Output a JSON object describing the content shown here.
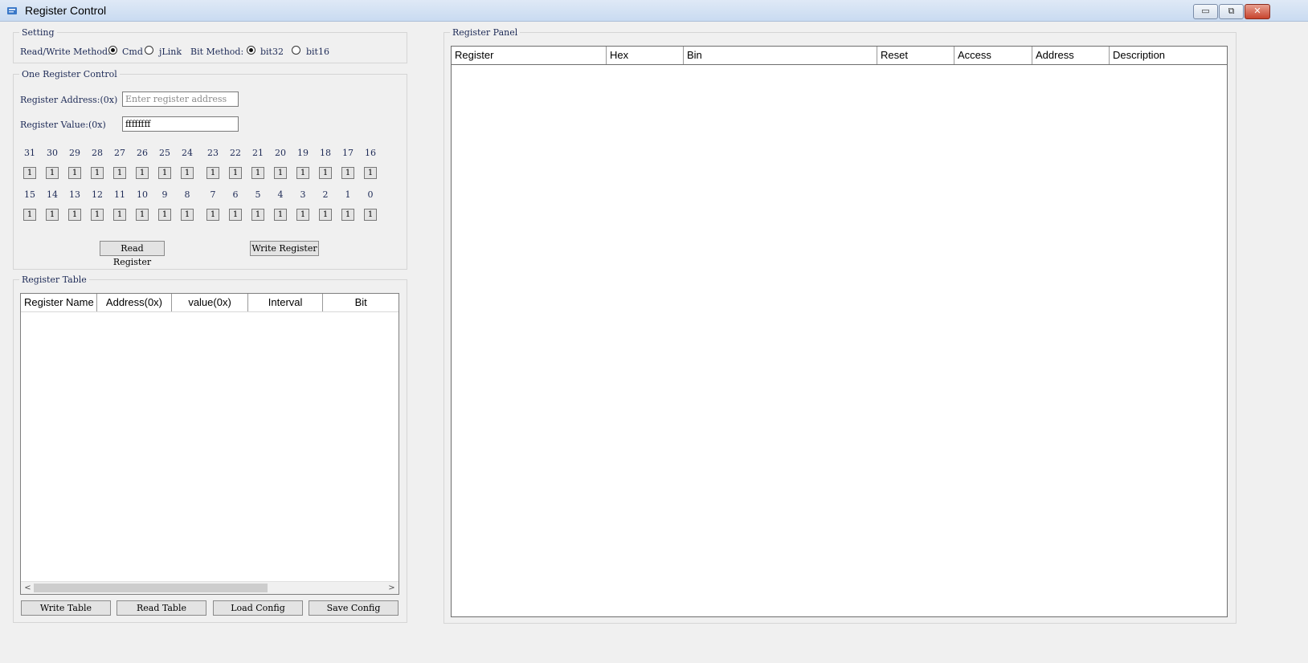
{
  "window": {
    "title": "Register Control",
    "controls": {
      "minimize": "▭",
      "restore": "⧉",
      "close": "✕"
    }
  },
  "setting": {
    "legend": "Setting",
    "rw_label": "Read/Write Method:",
    "rw_options": [
      {
        "label": "Cmd",
        "selected": true
      },
      {
        "label": "jLink",
        "selected": false
      }
    ],
    "bit_label": "Bit Method:",
    "bit_options": [
      {
        "label": "bit32",
        "selected": true
      },
      {
        "label": "bit16",
        "selected": false
      }
    ]
  },
  "one_register": {
    "legend": "One Register Control",
    "address_label": "Register Address:(0x)",
    "address_placeholder": "Enter register address",
    "value_label": "Register Value:(0x)",
    "value": "ffffffff",
    "bits": [
      {
        "n": "31",
        "v": "1"
      },
      {
        "n": "30",
        "v": "1"
      },
      {
        "n": "29",
        "v": "1"
      },
      {
        "n": "28",
        "v": "1"
      },
      {
        "n": "27",
        "v": "1"
      },
      {
        "n": "26",
        "v": "1"
      },
      {
        "n": "25",
        "v": "1"
      },
      {
        "n": "24",
        "v": "1"
      },
      {
        "n": "23",
        "v": "1"
      },
      {
        "n": "22",
        "v": "1"
      },
      {
        "n": "21",
        "v": "1"
      },
      {
        "n": "20",
        "v": "1"
      },
      {
        "n": "19",
        "v": "1"
      },
      {
        "n": "18",
        "v": "1"
      },
      {
        "n": "17",
        "v": "1"
      },
      {
        "n": "16",
        "v": "1"
      },
      {
        "n": "15",
        "v": "1"
      },
      {
        "n": "14",
        "v": "1"
      },
      {
        "n": "13",
        "v": "1"
      },
      {
        "n": "12",
        "v": "1"
      },
      {
        "n": "11",
        "v": "1"
      },
      {
        "n": "10",
        "v": "1"
      },
      {
        "n": "9",
        "v": "1"
      },
      {
        "n": "8",
        "v": "1"
      },
      {
        "n": "7",
        "v": "1"
      },
      {
        "n": "6",
        "v": "1"
      },
      {
        "n": "5",
        "v": "1"
      },
      {
        "n": "4",
        "v": "1"
      },
      {
        "n": "3",
        "v": "1"
      },
      {
        "n": "2",
        "v": "1"
      },
      {
        "n": "1",
        "v": "1"
      },
      {
        "n": "0",
        "v": "1"
      }
    ],
    "read_button": "Read Register",
    "write_button": "Write Register"
  },
  "register_table": {
    "legend": "Register Table",
    "columns": [
      "Register Name",
      "Address(0x)",
      "value(0x)",
      "Interval",
      "Bit"
    ],
    "scroll_left": "<",
    "scroll_right": ">",
    "buttons": [
      "Write Table",
      "Read Table",
      "Load Config",
      "Save Config"
    ]
  },
  "register_panel": {
    "legend": "Register Panel",
    "columns": [
      "Register",
      "Hex",
      "Bin",
      "Reset",
      "Access",
      "Address",
      "Description"
    ]
  }
}
